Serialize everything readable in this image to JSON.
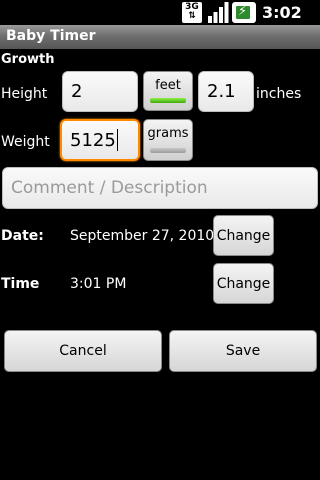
{
  "status_bar": {
    "network_label": "3G",
    "time": "3:02 PM",
    "icons": [
      "network-3g-icon",
      "signal-icon",
      "battery-charging-icon"
    ]
  },
  "app": {
    "title": "Baby Timer"
  },
  "form": {
    "section_title": "Growth",
    "height": {
      "label": "Height",
      "value": "2",
      "unit_toggle_label": "feet",
      "unit_toggle_on": true,
      "inches_value": "2.1",
      "inches_label": "inches"
    },
    "weight": {
      "label": "Weight",
      "value": "5125",
      "unit_toggle_label": "grams",
      "unit_toggle_on": false
    },
    "comment": {
      "placeholder": "Comment / Description",
      "value": ""
    },
    "date": {
      "label": "Date:",
      "value": "September 27, 2010",
      "change_label": "Change"
    },
    "time": {
      "label": "Time",
      "value": "3:01 PM",
      "change_label": "Change"
    }
  },
  "actions": {
    "cancel_label": "Cancel",
    "save_label": "Save"
  },
  "colors": {
    "focus": "#ff8a00",
    "toggle_on": "#5fd21f",
    "title_bar": "#7a7a7a"
  }
}
